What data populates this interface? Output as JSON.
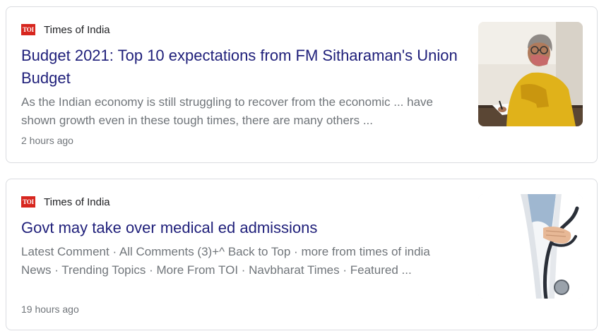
{
  "results": [
    {
      "source": "Times of India",
      "logo_text": "TOI",
      "headline": "Budget 2021: Top 10 expectations from FM Sitharaman's Union Budget",
      "snippet": "As the Indian economy is still struggling to recover from the economic ... have shown growth even in these tough times, there are many others ...",
      "time": "2 hours ago",
      "thumbnail_icon": "woman-in-yellow-saree-signing-document"
    },
    {
      "source": "Times of India",
      "logo_text": "TOI",
      "headline": "Govt may take over medical ed admissions",
      "snippet": "Latest Comment · All Comments (3)+^ Back to Top · more from times of india News · Trending Topics · More From TOI · Navbharat Times · Featured ...",
      "time": "19 hours ago",
      "thumbnail_icon": "doctor-with-stethoscope"
    }
  ],
  "colors": {
    "toi_red": "#d7261e",
    "card_border": "#dadce0",
    "snippet_gray": "#70757a"
  }
}
